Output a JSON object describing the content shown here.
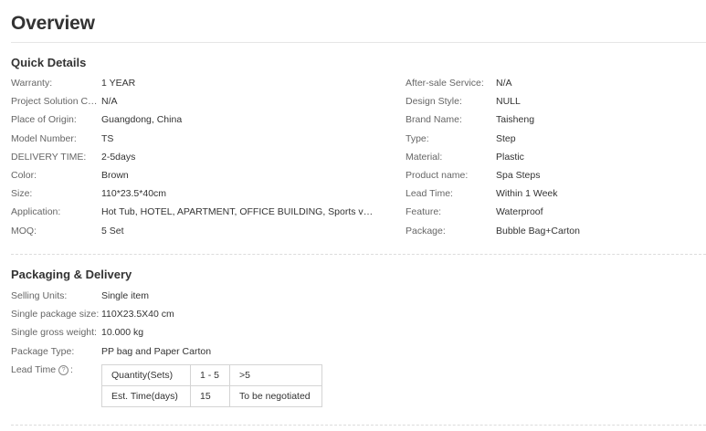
{
  "page_title": "Overview",
  "quick_details": {
    "heading": "Quick Details",
    "left": [
      {
        "label": "Warranty:",
        "value": "1 YEAR"
      },
      {
        "label": "Project Solution Ca...",
        "value": "N/A"
      },
      {
        "label": "Place of Origin:",
        "value": "Guangdong, China"
      },
      {
        "label": "Model Number:",
        "value": "TS"
      },
      {
        "label": "DELIVERY TIME:",
        "value": "2-5days"
      },
      {
        "label": "Color:",
        "value": "Brown"
      },
      {
        "label": "Size:",
        "value": "110*23.5*40cm"
      },
      {
        "label": "Application:",
        "value": "Hot Tub, HOTEL, APARTMENT, OFFICE BUILDING, Sports venu..."
      },
      {
        "label": "MOQ:",
        "value": "5 Set"
      }
    ],
    "right": [
      {
        "label": "After-sale Service:",
        "value": "N/A"
      },
      {
        "label": "Design Style:",
        "value": "NULL"
      },
      {
        "label": "Brand Name:",
        "value": "Taisheng"
      },
      {
        "label": "Type:",
        "value": "Step"
      },
      {
        "label": "Material:",
        "value": "Plastic"
      },
      {
        "label": "Product name:",
        "value": "Spa Steps"
      },
      {
        "label": "Lead Time:",
        "value": "Within 1 Week"
      },
      {
        "label": "Feature:",
        "value": "Waterproof"
      },
      {
        "label": "Package:",
        "value": "Bubble Bag+Carton"
      }
    ]
  },
  "packaging": {
    "heading": "Packaging & Delivery",
    "rows": [
      {
        "label": "Selling Units:",
        "value": "Single item"
      },
      {
        "label": "Single package size:",
        "value": "110X23.5X40 cm"
      },
      {
        "label": "Single gross weight:",
        "value": "10.000 kg"
      },
      {
        "label": "Package Type:",
        "value": "PP bag and Paper Carton"
      }
    ],
    "lead_time": {
      "label": "Lead Time",
      "help_icon": "question-circle-icon",
      "table": [
        [
          "Quantity(Sets)",
          "1 - 5",
          ">5"
        ],
        [
          "Est. Time(days)",
          "15",
          "To be negotiated"
        ]
      ]
    }
  }
}
